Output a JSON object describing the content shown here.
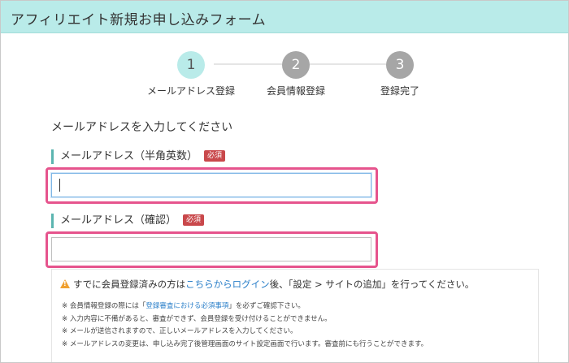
{
  "header": {
    "title": "アフィリエイト新規お申し込みフォーム"
  },
  "steps": [
    {
      "number": "1",
      "label": "メールアドレス登録",
      "active": true
    },
    {
      "number": "2",
      "label": "会員情報登録",
      "active": false
    },
    {
      "number": "3",
      "label": "登録完了",
      "active": false
    }
  ],
  "intro": "メールアドレスを入力してください",
  "fields": {
    "email": {
      "label": "メールアドレス（半角英数）",
      "badge": "必須",
      "value": ""
    },
    "email_confirm": {
      "label": "メールアドレス（確認）",
      "badge": "必須",
      "value": ""
    }
  },
  "notice": {
    "pre": "すでに会員登録済みの方は",
    "link": "こちらからログイン",
    "post": "後、「設定 > サイトの追加」を行ってください。",
    "notes": {
      "n1_pre": "※ 会員情報登録の際には「",
      "n1_link": "登録審査における必須事項",
      "n1_post": "」を必ずご確認下さい。",
      "n2": "※ 入力内容に不備があると、審査ができず、会員登録を受け付けることができません。",
      "n3": "※ メールが送信されますので、正しいメールアドレスを入力してください。",
      "n4": "※ メールアドレスの変更は、申し込み完了後管理画面のサイト設定画面で行います。審査前にも行うことができます。"
    }
  },
  "colors": {
    "header_bg": "#b9ebe9",
    "active_step": "#b9ebe9",
    "inactive_step": "#a6a6a6",
    "badge": "#c9484b",
    "highlight": "#e6548d",
    "link": "#2a7fc9",
    "warning": "#f0a030"
  }
}
